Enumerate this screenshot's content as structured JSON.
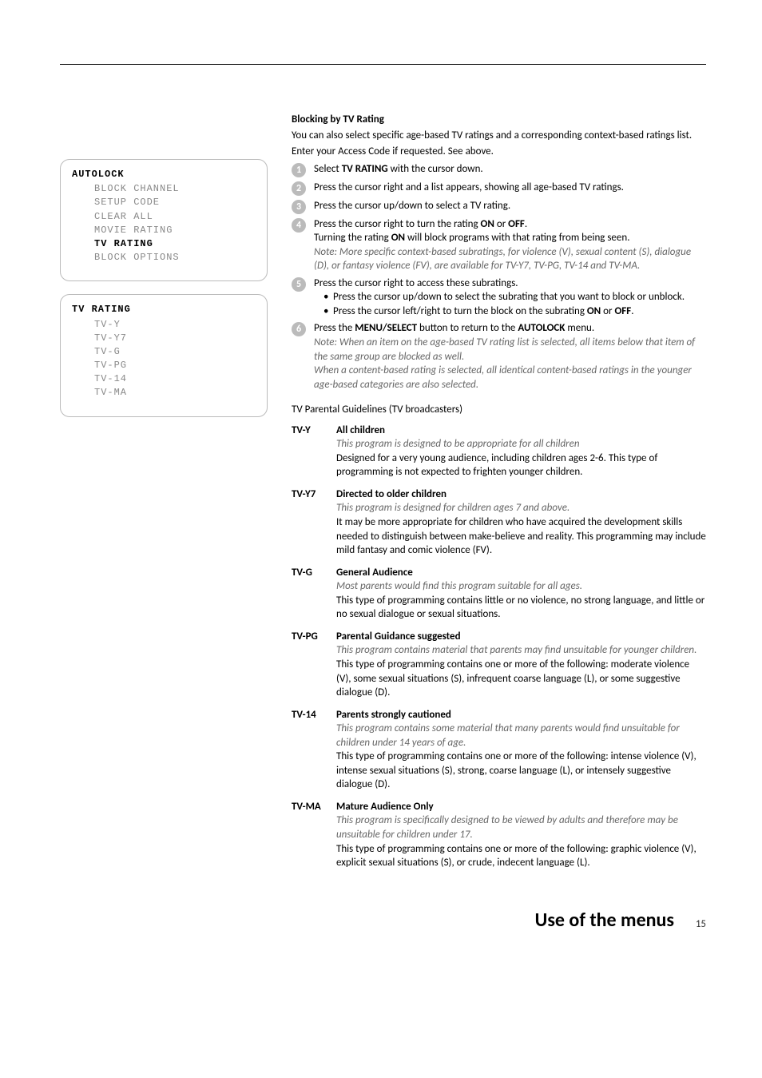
{
  "menuBox1": {
    "title": "AUTOLOCK",
    "items": [
      {
        "label": "BLOCK CHANNEL",
        "active": false
      },
      {
        "label": "SETUP CODE",
        "active": false
      },
      {
        "label": "CLEAR ALL",
        "active": false
      },
      {
        "label": "MOVIE RATING",
        "active": false
      },
      {
        "label": "TV RATING",
        "active": true
      },
      {
        "label": "BLOCK OPTIONS",
        "active": false
      }
    ]
  },
  "menuBox2": {
    "title": "TV RATING",
    "items": [
      {
        "label": "TV-Y",
        "active": false
      },
      {
        "label": "TV-Y7",
        "active": false
      },
      {
        "label": "TV-G",
        "active": false
      },
      {
        "label": "TV-PG",
        "active": false
      },
      {
        "label": "TV-14",
        "active": false
      },
      {
        "label": "TV-MA",
        "active": false
      }
    ]
  },
  "blocking": {
    "title": "Blocking by TV Rating",
    "intro1": "You can also select specific age-based TV ratings and a corresponding context-based ratings list.",
    "intro2": "Enter your Access Code if requested. See above."
  },
  "steps": {
    "s1_a": "Select ",
    "s1_b": "TV RATING",
    "s1_c": " with the cursor down.",
    "s2": "Press the cursor right and a list appears, showing all age-based TV ratings.",
    "s3": "Press the cursor up/down to select a TV rating.",
    "s4_a": "Press the cursor right to turn the rating ",
    "s4_on": "ON",
    "s4_or": " or ",
    "s4_off": "OFF",
    "s4_dot": ".",
    "s4_line2a": "Turning the rating ",
    "s4_line2b": "ON",
    "s4_line2c": " will block programs with that rating from being seen.",
    "s4_note": "Note: More specific context-based subratings, for violence (V), sexual content (S), dialogue (D), or fantasy violence (FV), are available for TV-Y7, TV-PG, TV-14 and TV-MA.",
    "s5_a": "Press the cursor right to access these subratings.",
    "s5_b1": "Press the cursor up/down to select the subrating that you want to block or unblock.",
    "s5_b2a": "Press the cursor left/right to turn the block on the subrating ",
    "s5_b2_on": "ON",
    "s5_b2_or": " or ",
    "s5_b2_off": "OFF",
    "s5_b2_dot": ".",
    "s6_a": "Press the ",
    "s6_b": "MENU/SELECT",
    "s6_c": " button to return to the ",
    "s6_d": "AUTOLOCK",
    "s6_e": " menu.",
    "s6_note1": "Note: When an item on the age-based TV rating list is selected, all items below that item of the same group are blocked as well.",
    "s6_note2": "When a content-based rating is selected, all identical content-based ratings in the younger age-based categories are also selected."
  },
  "guidelinesTitle": "TV Parental Guidelines (TV broadcasters)",
  "ratings": [
    {
      "code": "TV-Y",
      "heading": "All children",
      "tagline": "This program is designed to be appropriate for all children",
      "desc": "Designed for a very young audience, including children ages 2-6. This type of programming is not expected to frighten younger children."
    },
    {
      "code": "TV-Y7",
      "heading": "Directed to older children",
      "tagline": "This program is designed for children ages 7 and above.",
      "desc": "It may be more appropriate for children who have acquired the development skills needed to distinguish between make-believe and reality. This programming may include mild fantasy and comic violence (FV)."
    },
    {
      "code": "TV-G",
      "heading": "General Audience",
      "tagline": "Most parents would find this program suitable for all ages.",
      "desc": "This type of programming contains little or no violence, no strong language, and little or no sexual dialogue or sexual situations."
    },
    {
      "code": "TV-PG",
      "heading": "Parental Guidance suggested",
      "tagline": "This program contains material that parents may find unsuitable for younger children.",
      "desc": "This type of programming contains one or more of the following: moderate violence (V), some sexual situations (S), infrequent coarse language (L), or some suggestive dialogue (D)."
    },
    {
      "code": "TV-14",
      "heading": "Parents strongly cautioned",
      "tagline": "This program contains some material that many parents would find unsuitable for children under 14 years of age.",
      "desc": "This type of programming contains one or more of the following: intense violence (V), intense sexual situations (S), strong, coarse language (L), or intensely suggestive dialogue (D)."
    },
    {
      "code": "TV-MA",
      "heading": "Mature Audience Only",
      "tagline": "This program is specifically designed to be viewed by adults and therefore may be unsuitable for children under 17.",
      "desc": "This type of programming contains one or more of the following: graphic violence (V), explicit sexual situations (S), or crude, indecent language (L)."
    }
  ],
  "footer": {
    "title": "Use of the menus",
    "page": "15"
  }
}
